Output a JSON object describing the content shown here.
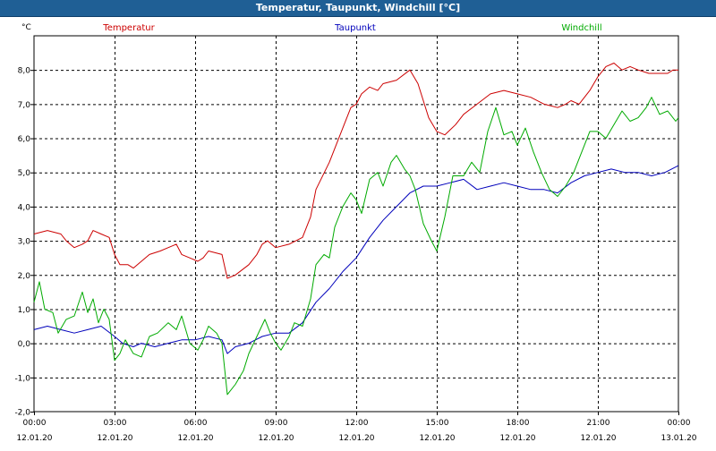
{
  "window": {
    "title": "Temperatur, Taupunkt, Windchill [°C]"
  },
  "chart_data": {
    "type": "line",
    "title": "Temperatur, Taupunkt, Windchill [°C]",
    "unit_label": "°C",
    "ylim": [
      -2.0,
      9.0
    ],
    "xlim": [
      0,
      24
    ],
    "grid": true,
    "legend_placement": "top",
    "y_ticks": [
      "-2,0",
      "-1,0",
      "0,0",
      "1,0",
      "2,0",
      "3,0",
      "4,0",
      "5,0",
      "6,0",
      "7,0",
      "8,0"
    ],
    "x_ticks": [
      {
        "hours": 0,
        "time": "00:00",
        "date": "12.01.20"
      },
      {
        "hours": 3,
        "time": "03:00",
        "date": "12.01.20"
      },
      {
        "hours": 6,
        "time": "06:00",
        "date": "12.01.20"
      },
      {
        "hours": 9,
        "time": "09:00",
        "date": "12.01.20"
      },
      {
        "hours": 12,
        "time": "12:00",
        "date": "12.01.20"
      },
      {
        "hours": 15,
        "time": "15:00",
        "date": "12.01.20"
      },
      {
        "hours": 18,
        "time": "18:00",
        "date": "12.01.20"
      },
      {
        "hours": 21,
        "time": "21:00",
        "date": "12.01.20"
      },
      {
        "hours": 24,
        "time": "00:00",
        "date": "13.01.20"
      }
    ],
    "series": [
      {
        "name": "Temperatur",
        "color": "#cc0000",
        "points": [
          [
            0.0,
            3.2
          ],
          [
            0.5,
            3.3
          ],
          [
            1.0,
            3.2
          ],
          [
            1.2,
            3.0
          ],
          [
            1.5,
            2.8
          ],
          [
            1.8,
            2.9
          ],
          [
            2.0,
            3.0
          ],
          [
            2.2,
            3.3
          ],
          [
            2.5,
            3.2
          ],
          [
            2.8,
            3.1
          ],
          [
            3.0,
            2.6
          ],
          [
            3.2,
            2.3
          ],
          [
            3.5,
            2.3
          ],
          [
            3.7,
            2.2
          ],
          [
            4.0,
            2.4
          ],
          [
            4.3,
            2.6
          ],
          [
            4.7,
            2.7
          ],
          [
            5.0,
            2.8
          ],
          [
            5.3,
            2.9
          ],
          [
            5.5,
            2.6
          ],
          [
            5.8,
            2.5
          ],
          [
            6.1,
            2.4
          ],
          [
            6.3,
            2.5
          ],
          [
            6.5,
            2.7
          ],
          [
            7.0,
            2.6
          ],
          [
            7.2,
            1.9
          ],
          [
            7.5,
            2.0
          ],
          [
            8.0,
            2.3
          ],
          [
            8.3,
            2.6
          ],
          [
            8.5,
            2.9
          ],
          [
            8.7,
            3.0
          ],
          [
            9.0,
            2.8
          ],
          [
            9.5,
            2.9
          ],
          [
            10.0,
            3.1
          ],
          [
            10.3,
            3.7
          ],
          [
            10.5,
            4.5
          ],
          [
            11.0,
            5.3
          ],
          [
            11.5,
            6.3
          ],
          [
            11.8,
            6.9
          ],
          [
            12.0,
            7.0
          ],
          [
            12.2,
            7.3
          ],
          [
            12.5,
            7.5
          ],
          [
            12.8,
            7.4
          ],
          [
            13.0,
            7.6
          ],
          [
            13.5,
            7.7
          ],
          [
            14.0,
            8.0
          ],
          [
            14.3,
            7.6
          ],
          [
            14.7,
            6.6
          ],
          [
            15.0,
            6.2
          ],
          [
            15.3,
            6.1
          ],
          [
            15.7,
            6.4
          ],
          [
            16.0,
            6.7
          ],
          [
            16.5,
            7.0
          ],
          [
            17.0,
            7.3
          ],
          [
            17.5,
            7.4
          ],
          [
            18.0,
            7.3
          ],
          [
            18.5,
            7.2
          ],
          [
            19.0,
            7.0
          ],
          [
            19.5,
            6.9
          ],
          [
            19.8,
            7.0
          ],
          [
            20.0,
            7.1
          ],
          [
            20.3,
            7.0
          ],
          [
            20.7,
            7.4
          ],
          [
            21.0,
            7.8
          ],
          [
            21.3,
            8.1
          ],
          [
            21.6,
            8.2
          ],
          [
            21.9,
            8.0
          ],
          [
            22.2,
            8.1
          ],
          [
            22.5,
            8.0
          ],
          [
            22.9,
            7.9
          ],
          [
            23.3,
            7.9
          ],
          [
            23.6,
            7.9
          ],
          [
            23.8,
            8.0
          ],
          [
            24.0,
            8.0
          ]
        ]
      },
      {
        "name": "Taupunkt",
        "color": "#0000bb",
        "points": [
          [
            0.0,
            0.4
          ],
          [
            0.5,
            0.5
          ],
          [
            1.0,
            0.4
          ],
          [
            1.5,
            0.3
          ],
          [
            2.0,
            0.4
          ],
          [
            2.5,
            0.5
          ],
          [
            3.0,
            0.2
          ],
          [
            3.3,
            0.0
          ],
          [
            3.7,
            -0.1
          ],
          [
            4.0,
            0.0
          ],
          [
            4.5,
            -0.1
          ],
          [
            5.0,
            0.0
          ],
          [
            5.5,
            0.1
          ],
          [
            6.0,
            0.1
          ],
          [
            6.5,
            0.2
          ],
          [
            7.0,
            0.1
          ],
          [
            7.2,
            -0.3
          ],
          [
            7.5,
            -0.1
          ],
          [
            8.0,
            0.0
          ],
          [
            8.5,
            0.2
          ],
          [
            9.0,
            0.3
          ],
          [
            9.5,
            0.3
          ],
          [
            10.0,
            0.6
          ],
          [
            10.5,
            1.2
          ],
          [
            11.0,
            1.6
          ],
          [
            11.5,
            2.1
          ],
          [
            12.0,
            2.5
          ],
          [
            12.5,
            3.1
          ],
          [
            13.0,
            3.6
          ],
          [
            13.5,
            4.0
          ],
          [
            14.0,
            4.4
          ],
          [
            14.5,
            4.6
          ],
          [
            15.0,
            4.6
          ],
          [
            15.5,
            4.7
          ],
          [
            16.0,
            4.8
          ],
          [
            16.5,
            4.5
          ],
          [
            17.0,
            4.6
          ],
          [
            17.5,
            4.7
          ],
          [
            18.0,
            4.6
          ],
          [
            18.5,
            4.5
          ],
          [
            19.0,
            4.5
          ],
          [
            19.5,
            4.4
          ],
          [
            20.0,
            4.7
          ],
          [
            20.5,
            4.9
          ],
          [
            21.0,
            5.0
          ],
          [
            21.5,
            5.1
          ],
          [
            22.0,
            5.0
          ],
          [
            22.5,
            5.0
          ],
          [
            23.0,
            4.9
          ],
          [
            23.5,
            5.0
          ],
          [
            24.0,
            5.2
          ]
        ]
      },
      {
        "name": "Windchill",
        "color": "#00aa00",
        "points": [
          [
            0.0,
            1.2
          ],
          [
            0.2,
            1.8
          ],
          [
            0.4,
            1.0
          ],
          [
            0.7,
            0.9
          ],
          [
            0.9,
            0.3
          ],
          [
            1.2,
            0.7
          ],
          [
            1.5,
            0.8
          ],
          [
            1.8,
            1.5
          ],
          [
            2.0,
            0.9
          ],
          [
            2.2,
            1.3
          ],
          [
            2.4,
            0.6
          ],
          [
            2.6,
            1.0
          ],
          [
            2.8,
            0.7
          ],
          [
            3.0,
            -0.5
          ],
          [
            3.2,
            -0.3
          ],
          [
            3.4,
            0.1
          ],
          [
            3.7,
            -0.3
          ],
          [
            4.0,
            -0.4
          ],
          [
            4.3,
            0.2
          ],
          [
            4.6,
            0.3
          ],
          [
            5.0,
            0.6
          ],
          [
            5.3,
            0.4
          ],
          [
            5.5,
            0.8
          ],
          [
            5.8,
            0.0
          ],
          [
            6.1,
            -0.2
          ],
          [
            6.3,
            0.1
          ],
          [
            6.5,
            0.5
          ],
          [
            6.8,
            0.3
          ],
          [
            7.0,
            0.0
          ],
          [
            7.2,
            -1.5
          ],
          [
            7.5,
            -1.2
          ],
          [
            7.8,
            -0.8
          ],
          [
            8.0,
            -0.3
          ],
          [
            8.3,
            0.2
          ],
          [
            8.6,
            0.7
          ],
          [
            8.8,
            0.3
          ],
          [
            9.0,
            0.0
          ],
          [
            9.2,
            -0.2
          ],
          [
            9.5,
            0.2
          ],
          [
            9.7,
            0.6
          ],
          [
            10.0,
            0.5
          ],
          [
            10.3,
            1.3
          ],
          [
            10.5,
            2.3
          ],
          [
            10.8,
            2.6
          ],
          [
            11.0,
            2.5
          ],
          [
            11.2,
            3.4
          ],
          [
            11.5,
            4.0
          ],
          [
            11.8,
            4.4
          ],
          [
            12.0,
            4.2
          ],
          [
            12.2,
            3.8
          ],
          [
            12.5,
            4.8
          ],
          [
            12.8,
            5.0
          ],
          [
            13.0,
            4.6
          ],
          [
            13.3,
            5.3
          ],
          [
            13.5,
            5.5
          ],
          [
            13.8,
            5.1
          ],
          [
            14.0,
            4.9
          ],
          [
            14.2,
            4.5
          ],
          [
            14.5,
            3.5
          ],
          [
            14.8,
            3.0
          ],
          [
            15.0,
            2.7
          ],
          [
            15.3,
            3.7
          ],
          [
            15.6,
            4.9
          ],
          [
            16.0,
            4.9
          ],
          [
            16.3,
            5.3
          ],
          [
            16.6,
            5.0
          ],
          [
            16.9,
            6.2
          ],
          [
            17.2,
            6.9
          ],
          [
            17.5,
            6.1
          ],
          [
            17.8,
            6.2
          ],
          [
            18.0,
            5.8
          ],
          [
            18.3,
            6.3
          ],
          [
            18.6,
            5.6
          ],
          [
            18.9,
            5.0
          ],
          [
            19.2,
            4.5
          ],
          [
            19.5,
            4.3
          ],
          [
            19.8,
            4.6
          ],
          [
            20.1,
            5.0
          ],
          [
            20.4,
            5.6
          ],
          [
            20.7,
            6.2
          ],
          [
            21.0,
            6.2
          ],
          [
            21.3,
            6.0
          ],
          [
            21.6,
            6.4
          ],
          [
            21.9,
            6.8
          ],
          [
            22.2,
            6.5
          ],
          [
            22.5,
            6.6
          ],
          [
            22.8,
            6.9
          ],
          [
            23.0,
            7.2
          ],
          [
            23.3,
            6.7
          ],
          [
            23.6,
            6.8
          ],
          [
            23.9,
            6.5
          ],
          [
            24.0,
            6.6
          ]
        ]
      }
    ]
  }
}
